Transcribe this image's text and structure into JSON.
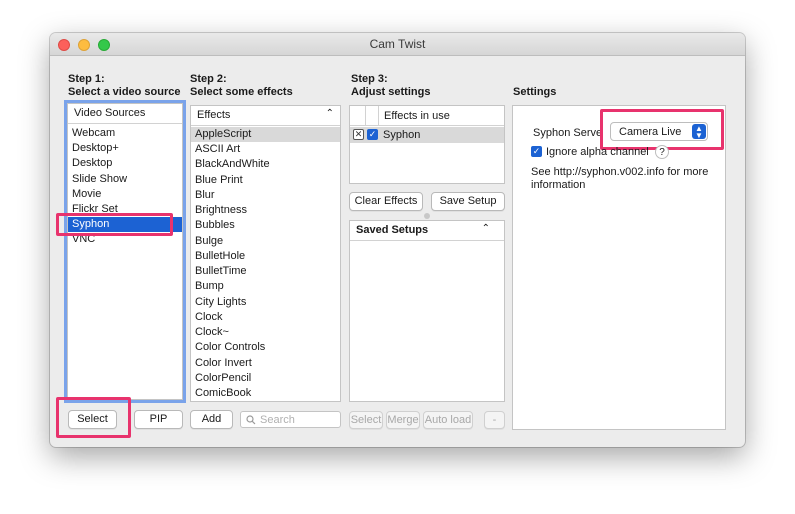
{
  "window": {
    "title": "Cam Twist"
  },
  "step1": {
    "line1": "Step 1:",
    "line2": "Select a video source",
    "list_header": "Video Sources",
    "items": [
      "Webcam",
      "Desktop+",
      "Desktop",
      "Slide Show",
      "Movie",
      "Flickr Set",
      "Syphon",
      "VNC"
    ],
    "selected": "Syphon",
    "select_button": "Select",
    "pip_button": "PIP"
  },
  "step2": {
    "line1": "Step 2:",
    "line2": "Select some effects",
    "list_header": "Effects",
    "items": [
      "AppleScript",
      "ASCII Art",
      "BlackAndWhite",
      "Blue Print",
      "Blur",
      "Brightness",
      "Bubbles",
      "Bulge",
      "BulletHole",
      "BulletTime",
      "Bump",
      "City Lights",
      "Clock",
      "Clock~",
      "Color Controls",
      "Color Invert",
      "ColorPencil",
      "ComicBook"
    ],
    "add_button": "Add",
    "search_placeholder": "Search"
  },
  "step3": {
    "line1": "Step 3:",
    "line2": "Adjust settings",
    "effects_header": "Effects in use",
    "effect_row": "Syphon",
    "clear_button": "Clear Effects",
    "save_button": "Save Setup",
    "saved_header": "Saved Setups",
    "select_button": "Select",
    "merge_button": "Merge",
    "autoload_button": "Auto load",
    "minus_button": "-"
  },
  "settings": {
    "heading": "Settings",
    "server_label": "Syphon Serve",
    "server_value": "Camera Live",
    "ignore_alpha_label": "Ignore alpha channel",
    "help_glyph": "?",
    "info_text": "See http://syphon.v002.info for more information"
  },
  "colors": {
    "highlight": "#e8336d",
    "selection_blue": "#1c62d3",
    "focus_ring": "#7aa3ea"
  }
}
